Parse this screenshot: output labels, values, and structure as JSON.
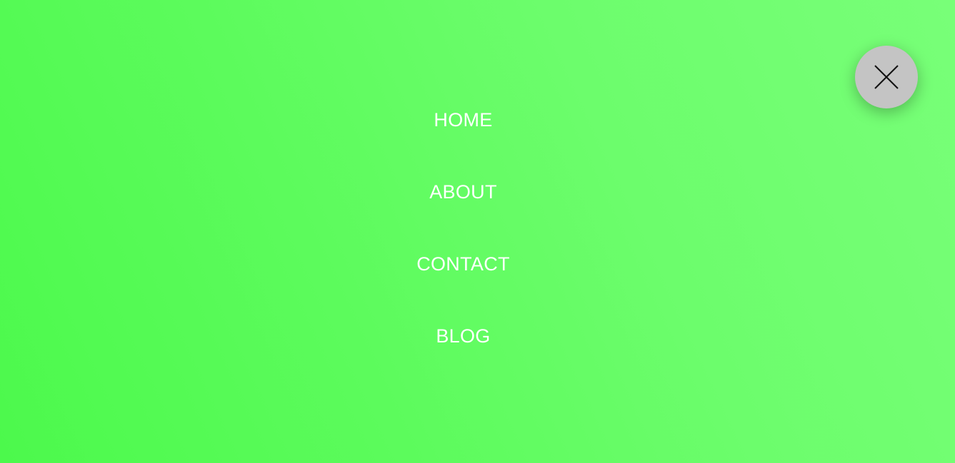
{
  "menu": {
    "items": [
      {
        "label": "HOME"
      },
      {
        "label": "ABOUT"
      },
      {
        "label": "CONTACT"
      },
      {
        "label": "BLOG"
      }
    ],
    "close_icon": "close-icon"
  },
  "colors": {
    "background_start": "#4cf94c",
    "background_end": "#78ff78",
    "text": "#ffffff",
    "close_button": "#c4c4c4",
    "close_icon": "#111111"
  }
}
